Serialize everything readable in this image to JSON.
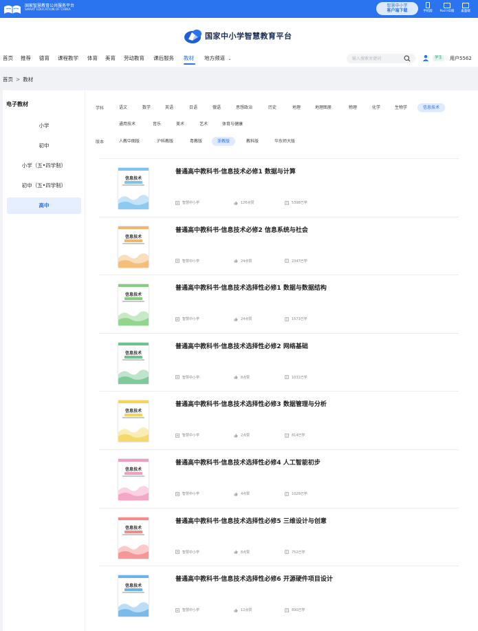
{
  "topbar": {
    "org_name": "国家智慧教育公共服务平台",
    "org_name_en": "SMART EDUCATION OF CHINA",
    "app_download_line1": "智慧中小学",
    "app_download_line2": "客户端下载",
    "devices": [
      {
        "label": "手机版",
        "icon": "phone-icon"
      },
      {
        "label": "Pad HD版",
        "icon": "tablet-icon"
      },
      {
        "label": "桌面端",
        "icon": "desktop-icon"
      }
    ]
  },
  "header": {
    "brand_name": "国家中小学智慧教育平台",
    "nav": [
      "首页",
      "推荐",
      "德育",
      "课程教学",
      "体育",
      "美育",
      "劳动教育",
      "课后服务",
      "教材",
      "地方频道"
    ],
    "nav_active_index": 8,
    "search_placeholder": "输入搜索关键词",
    "role_badge": "学生",
    "username": "用户5562"
  },
  "breadcrumb": {
    "home": "首页",
    "separator": ">",
    "current": "教材"
  },
  "sidebar": {
    "title": "电子教材",
    "items": [
      "小学",
      "初中",
      "小学（五•四学制）",
      "初中（五•四学制）",
      "高中"
    ],
    "active_index": 4
  },
  "filters": {
    "subject_label": "学科",
    "subjects_row1": [
      "语文",
      "数学",
      "英语",
      "日语",
      "俄语",
      "思想政治",
      "历史",
      "地理",
      "地理图册",
      "物理",
      "化学",
      "生物学",
      "信息技术"
    ],
    "subjects_row2": [
      "通用技术",
      "音乐",
      "美术",
      "艺术",
      "体育与健康"
    ],
    "active_subject": "信息技术",
    "edition_label": "版本",
    "editions": [
      "人教中图版",
      "沪科教版",
      "粤教版",
      "浙教版",
      "教科版",
      "华东师大版"
    ],
    "active_edition": "浙教版"
  },
  "books": [
    {
      "title": "普通高中教科书·信息技术必修1 数据与计算",
      "source": "智慧中小学",
      "likes": "126点赞",
      "learners": "5398已学",
      "cover_color": "#7ec3ef"
    },
    {
      "title": "普通高中教科书·信息技术必修2 信息系统与社会",
      "source": "智慧中小学",
      "likes": "24点赞",
      "learners": "2347已学",
      "cover_color": "#f2b56b"
    },
    {
      "title": "普通高中教科书·信息技术选择性必修1 数据与数据结构",
      "source": "智慧中小学",
      "likes": "24点赞",
      "learners": "1573已学",
      "cover_color": "#86cf7f"
    },
    {
      "title": "普通高中教科书·信息技术选择性必修2 网络基础",
      "source": "智慧中小学",
      "likes": "8点赞",
      "learners": "1031已学",
      "cover_color": "#6fc38f"
    },
    {
      "title": "普通高中教科书·信息技术选择性必修3 数据管理与分析",
      "source": "智慧中小学",
      "likes": "2点赞",
      "learners": "814已学",
      "cover_color": "#f5d45a"
    },
    {
      "title": "普通高中教科书·信息技术选择性必修4 人工智能初步",
      "source": "智慧中小学",
      "likes": "4点赞",
      "learners": "1028已学",
      "cover_color": "#f49cc0"
    },
    {
      "title": "普通高中教科书·信息技术选择性必修5 三维设计与创意",
      "source": "智慧中小学",
      "likes": "8点赞",
      "learners": "752已学",
      "cover_color": "#f58a8a"
    },
    {
      "title": "普通高中教科书·信息技术选择性必修6 开源硬件项目设计",
      "source": "智慧中小学",
      "likes": "12点赞",
      "learners": "890已学",
      "cover_color": "#6ab3ea"
    }
  ],
  "cover_text": "信息技术",
  "colors": {
    "accent": "#2b74f0",
    "topbar": "#2b74f0",
    "active_bg": "#e6efff"
  }
}
